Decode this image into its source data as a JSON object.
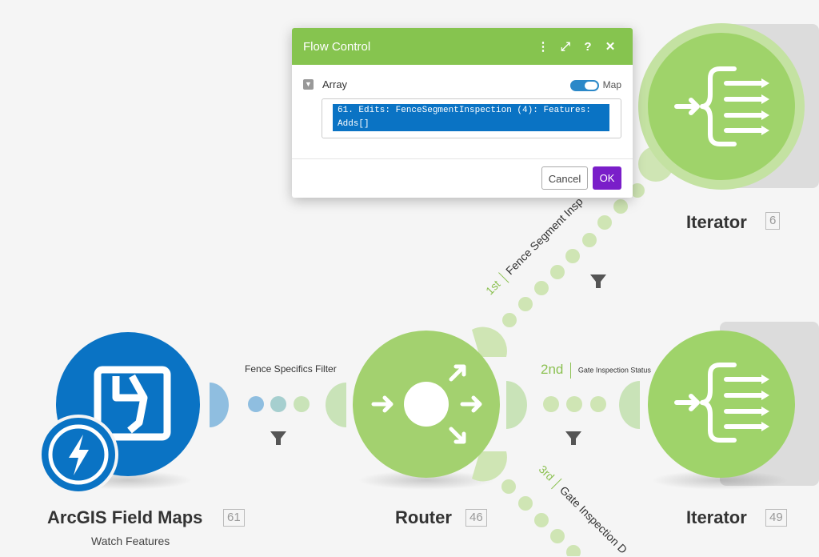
{
  "colors": {
    "router_green": "#a3d16f",
    "iterator_green": "#9fd36a",
    "arcgis_blue": "#0a73c4",
    "dot_green": "#d1e6b8",
    "dot_blue": "#8fbee0",
    "accent_ok": "#7a1ec9"
  },
  "modules": {
    "arcgis": {
      "title": "ArcGIS Field Maps",
      "badge": "61",
      "subtitle": "Watch Features",
      "icon": "arcgis-field-maps-icon"
    },
    "router": {
      "title": "Router",
      "badge": "46",
      "icon": "router-arrows-icon"
    },
    "iterator_top": {
      "title": "Iterator",
      "badge": "6",
      "icon": "iterator-icon"
    },
    "iterator_bottom": {
      "title": "Iterator",
      "badge": "49",
      "icon": "iterator-icon"
    }
  },
  "routes": {
    "filter_label": "Fence Specifics Filter",
    "first": {
      "num": "1st",
      "label": "Fence Segment Insp"
    },
    "second": {
      "num": "2nd",
      "label": "Gate Inspection Status"
    },
    "third": {
      "num": "3rd",
      "label": "Gate Inspection D"
    }
  },
  "dialog": {
    "title": "Flow Control",
    "field_label": "Array",
    "map_label": "Map",
    "array_value": "61. Edits: FenceSegmentInspection (4): Features: Adds[]",
    "cancel_label": "Cancel",
    "ok_label": "OK"
  }
}
